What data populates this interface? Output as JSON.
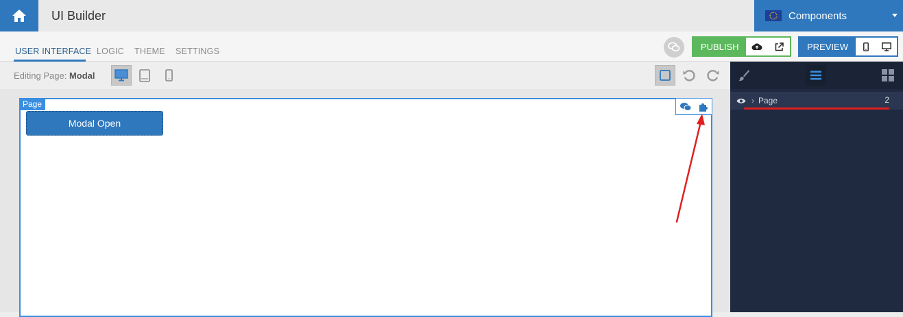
{
  "header": {
    "title": "UI Builder",
    "components_label": "Components"
  },
  "tabs": [
    {
      "label": "USER INTERFACE",
      "active": true
    },
    {
      "label": "LOGIC",
      "active": false
    },
    {
      "label": "THEME",
      "active": false
    },
    {
      "label": "SETTINGS",
      "active": false
    }
  ],
  "actions": {
    "publish_label": "PUBLISH",
    "preview_label": "PREVIEW"
  },
  "editbar": {
    "editing_prefix": "Editing Page:",
    "page_name": "Modal",
    "selected_device": "desktop"
  },
  "canvas": {
    "page_tag": "Page",
    "button_label": "Modal Open"
  },
  "sidebar": {
    "active_tool": "layers",
    "tree": [
      {
        "label": "Page",
        "count": "2"
      }
    ]
  },
  "colors": {
    "primary": "#2f78bd",
    "publish_green": "#5cb85c",
    "sidebar_bg": "#1f2a41",
    "annotation_red": "#e02020"
  },
  "icons": [
    "home-icon",
    "eu-flag-icon",
    "chat-icon",
    "cloud-upload-icon",
    "external-link-icon",
    "mobile-icon",
    "monitor-icon",
    "tablet-icon",
    "square-icon",
    "undo-icon",
    "redo-icon",
    "comments-icon",
    "puzzle-icon",
    "brush-icon",
    "list-icon",
    "grid-icon",
    "eye-icon",
    "chevron-right-icon"
  ]
}
